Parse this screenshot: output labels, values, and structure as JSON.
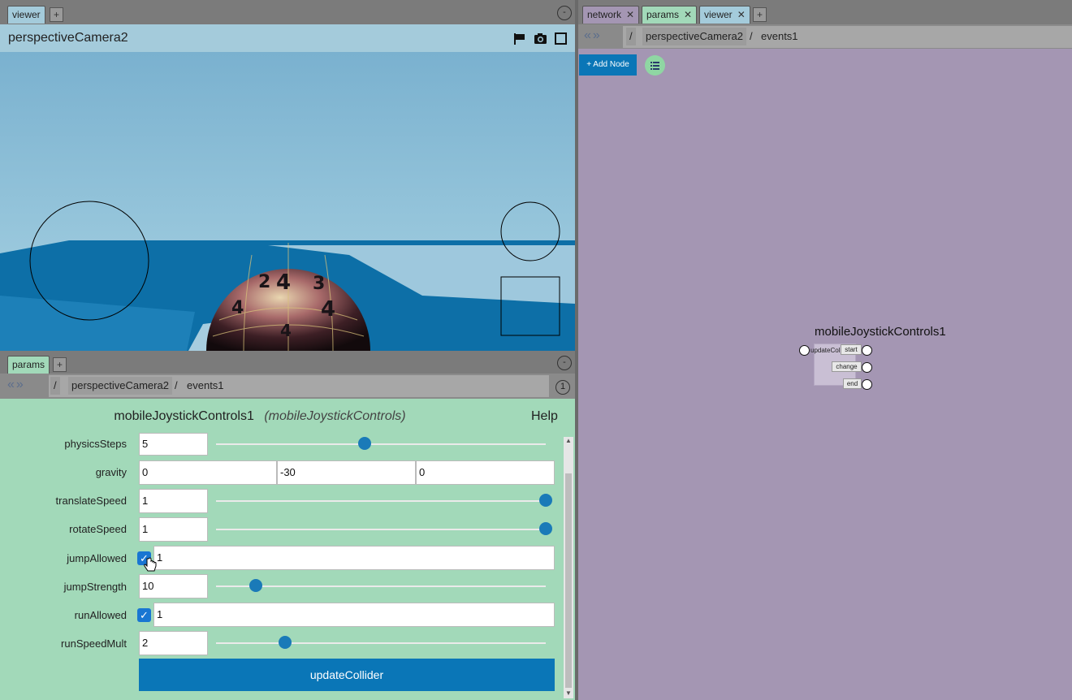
{
  "left_tabs": {
    "viewer_tab": "viewer",
    "plus": "+",
    "minimize": "-"
  },
  "viewer": {
    "camera_name": "perspectiveCamera2"
  },
  "params_tabs": {
    "params_tab": "params",
    "plus": "+",
    "minimize": "-"
  },
  "params_path": {
    "root": "/",
    "node": "perspectiveCamera2",
    "sep": "/",
    "child": "events1",
    "counter": "1"
  },
  "params": {
    "node_name": "mobileJoystickControls1",
    "node_type": "(mobileJoystickControls)",
    "help": "Help",
    "rows": {
      "physicsSteps": {
        "label": "physicsSteps",
        "value": "5",
        "slider": 0.45
      },
      "gravity": {
        "label": "gravity",
        "x": "0",
        "y": "-30",
        "z": "0"
      },
      "translateSpeed": {
        "label": "translateSpeed",
        "value": "1",
        "slider": 1.0
      },
      "rotateSpeed": {
        "label": "rotateSpeed",
        "value": "1",
        "slider": 1.0
      },
      "jumpAllowed": {
        "label": "jumpAllowed",
        "value": "1",
        "check": "✓"
      },
      "jumpStrength": {
        "label": "jumpStrength",
        "value": "10",
        "slider": 0.12
      },
      "runAllowed": {
        "label": "runAllowed",
        "value": "1",
        "check": "✓"
      },
      "runSpeedMult": {
        "label": "runSpeedMult",
        "value": "2",
        "slider": 0.21
      }
    },
    "update_button": "updateCollider"
  },
  "right_tabs": {
    "network": "network",
    "params": "params",
    "viewer": "viewer",
    "close": "✕",
    "plus": "+"
  },
  "network_path": {
    "arrows": "«»",
    "root": "/",
    "node": "perspectiveCamera2",
    "sep": "/",
    "child": "events1"
  },
  "network": {
    "add_node": "+ Add Node",
    "node_title": "mobileJoystickControls1",
    "input": "updateCollider",
    "outputs": [
      "start",
      "change",
      "end"
    ]
  },
  "colors": {
    "accent": "#0a76b7",
    "params_bg": "#a2d9b9",
    "network_bg": "#a496b3",
    "viewer_header": "#a4cbdb"
  }
}
